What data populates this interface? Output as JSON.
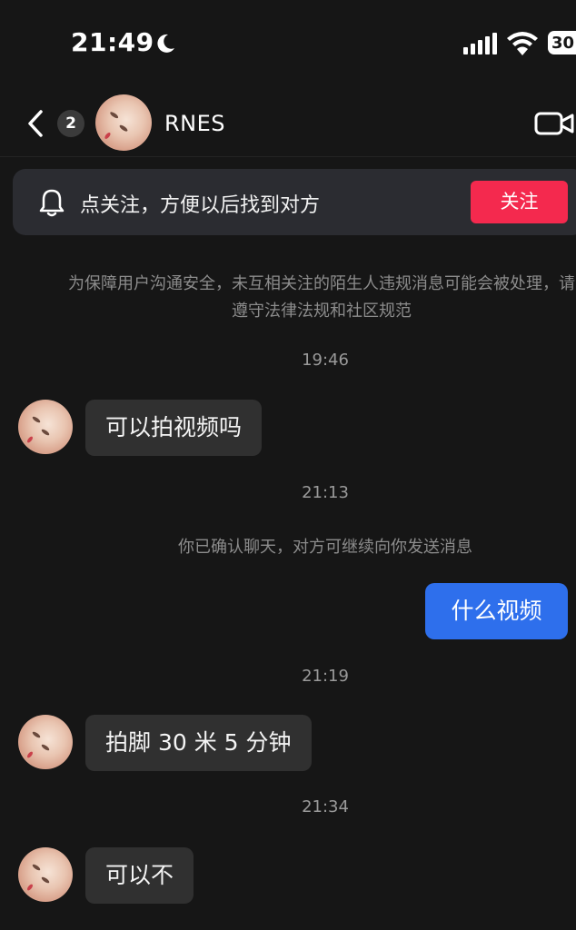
{
  "status_bar": {
    "time": "21:49",
    "battery": "30"
  },
  "header": {
    "unread_count": "2",
    "username": "RNES"
  },
  "follow_banner": {
    "text": "点关注，方便以后找到对方",
    "button_label": "关注"
  },
  "notice": "为保障用户沟通安全，未互相关注的陌生人违规消息可能会被处理，请遵守法律法规和社区规范",
  "messages": [
    {
      "type": "timestamp",
      "text": "19:46"
    },
    {
      "type": "incoming",
      "text": "可以拍视频吗"
    },
    {
      "type": "timestamp",
      "text": "21:13"
    },
    {
      "type": "system",
      "text": "你已确认聊天，对方可继续向你发送消息"
    },
    {
      "type": "outgoing",
      "text": "什么视频"
    },
    {
      "type": "timestamp",
      "text": "21:19"
    },
    {
      "type": "incoming",
      "text": "拍脚 30 米 5 分钟"
    },
    {
      "type": "timestamp",
      "text": "21:34"
    },
    {
      "type": "incoming",
      "text": "可以不"
    }
  ],
  "colors": {
    "background": "#161616",
    "follow_button": "#f4294e",
    "outgoing_bubble": "#2e6fec",
    "incoming_bubble": "#303030"
  }
}
